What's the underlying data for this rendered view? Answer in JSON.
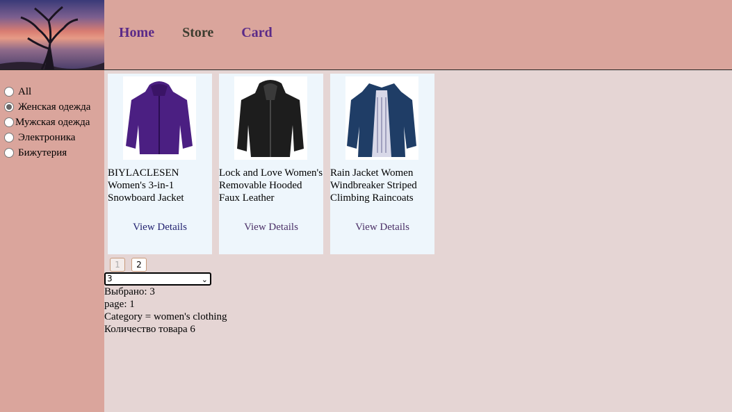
{
  "nav": {
    "home": "Home",
    "store": "Store",
    "card": "Card"
  },
  "categories": [
    {
      "label": "All",
      "checked": false
    },
    {
      "label": "Женская одежда",
      "checked": true
    },
    {
      "label": "Мужская одежда",
      "checked": false
    },
    {
      "label": "Электроника",
      "checked": false
    },
    {
      "label": "Бижутерия",
      "checked": false
    }
  ],
  "products": [
    {
      "title": "BIYLACLESEN Women's 3-in-1 Snowboard Jacket",
      "details": "View Details",
      "image": "purple-jacket"
    },
    {
      "title": "Lock and Love Women's Removable Hooded Faux Leather",
      "details": "View Details",
      "image": "black-leather-jacket"
    },
    {
      "title": "Rain Jacket Women Windbreaker Striped Climbing Raincoats",
      "details": "View Details",
      "image": "navy-rain-jacket"
    }
  ],
  "pagination": {
    "pages": [
      "1",
      "2"
    ],
    "current": "1"
  },
  "per_page_select": {
    "value": "3"
  },
  "info": {
    "selected": "Выбрано: 3",
    "page": "page: 1",
    "category": "Category = women's clothing",
    "count": "Количество товара 6"
  },
  "colors": {
    "header_bg": "#daa59c",
    "main_bg": "#e5d5d4",
    "card_bg": "#eef6fc",
    "nav_link": "#5a2a88"
  }
}
